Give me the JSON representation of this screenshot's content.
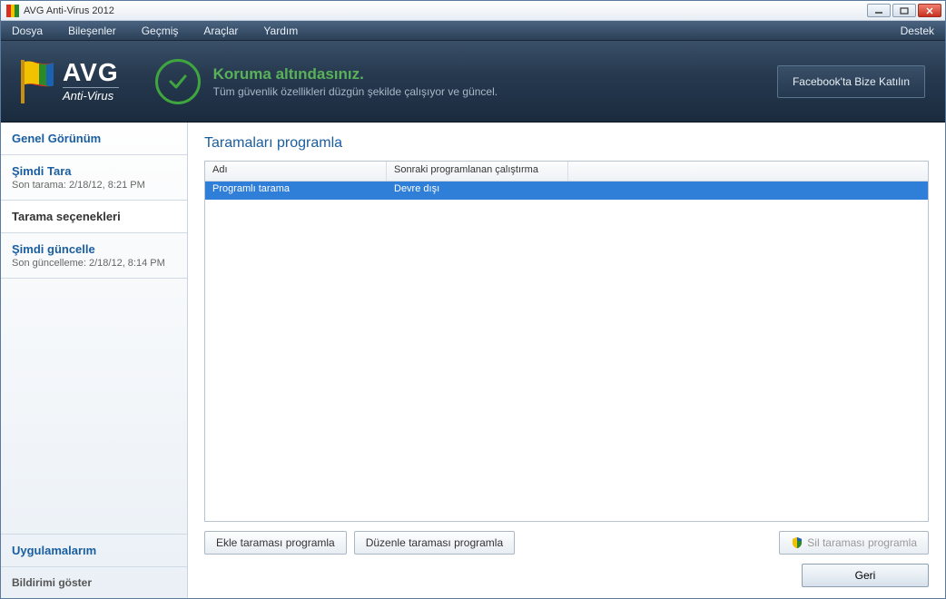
{
  "window": {
    "title": "AVG Anti-Virus 2012"
  },
  "menu": {
    "file": "Dosya",
    "components": "Bileşenler",
    "history": "Geçmiş",
    "tools": "Araçlar",
    "help": "Yardım",
    "support": "Destek"
  },
  "logo": {
    "brand": "AVG",
    "subtitle": "Anti-Virus"
  },
  "status": {
    "title": "Koruma altındasınız.",
    "subtitle": "Tüm güvenlik özellikleri düzgün şekilde çalışıyor ve güncel."
  },
  "facebook_button": "Facebook'ta Bize Katılın",
  "sidebar": {
    "overview": "Genel Görünüm",
    "scan_now": "Şimdi Tara",
    "scan_now_sub": "Son tarama: 2/18/12, 8:21 PM",
    "scan_options": "Tarama seçenekleri",
    "update_now": "Şimdi güncelle",
    "update_now_sub": "Son güncelleme: 2/18/12, 8:14 PM",
    "my_apps": "Uygulamalarım",
    "show_notification": "Bildirimi göster"
  },
  "content": {
    "heading": "Taramaları programla",
    "columns": {
      "name": "Adı",
      "next_run": "Sonraki programlanan çalıştırma"
    },
    "rows": [
      {
        "name": "Programlı tarama",
        "next_run": "Devre dışı"
      }
    ],
    "buttons": {
      "add": "Ekle taraması programla",
      "edit": "Düzenle taraması programla",
      "delete": "Sil taraması programla",
      "back": "Geri"
    }
  }
}
